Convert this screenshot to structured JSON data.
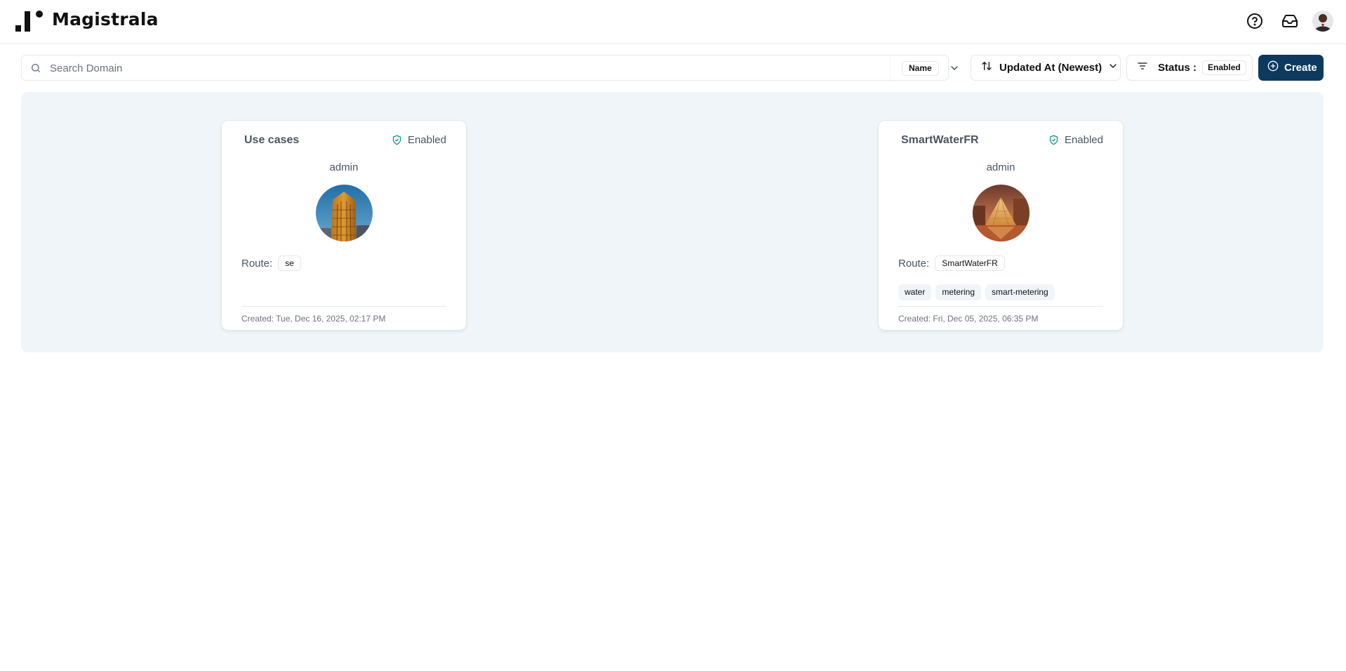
{
  "header": {
    "brand": "Magistrala",
    "icons": [
      "help-circle-icon",
      "inbox-icon"
    ]
  },
  "toolbar": {
    "search_placeholder": "Search Domain",
    "search_field_badge": "Name",
    "sort_label": "Updated At (Newest)",
    "status_label": "Status :",
    "status_value": "Enabled",
    "create_label": "Create"
  },
  "colors": {
    "primary": "#0b3a5e",
    "grid_bg": "#eff5f8",
    "enabled_icon": "#0d9488"
  },
  "domains": [
    {
      "name": "Use cases",
      "status": "Enabled",
      "owner": "admin",
      "route_label": "Route:",
      "route": "se",
      "tags": [],
      "created": "Created: Tue, Dec 16, 2025, 02:17 PM"
    },
    {
      "name": "SmartWaterFR",
      "status": "Enabled",
      "owner": "admin",
      "route_label": "Route:",
      "route": "SmartWaterFR",
      "tags": [
        "water",
        "metering",
        "smart-metering"
      ],
      "created": "Created: Fri, Dec 05, 2025, 06:35 PM"
    }
  ]
}
